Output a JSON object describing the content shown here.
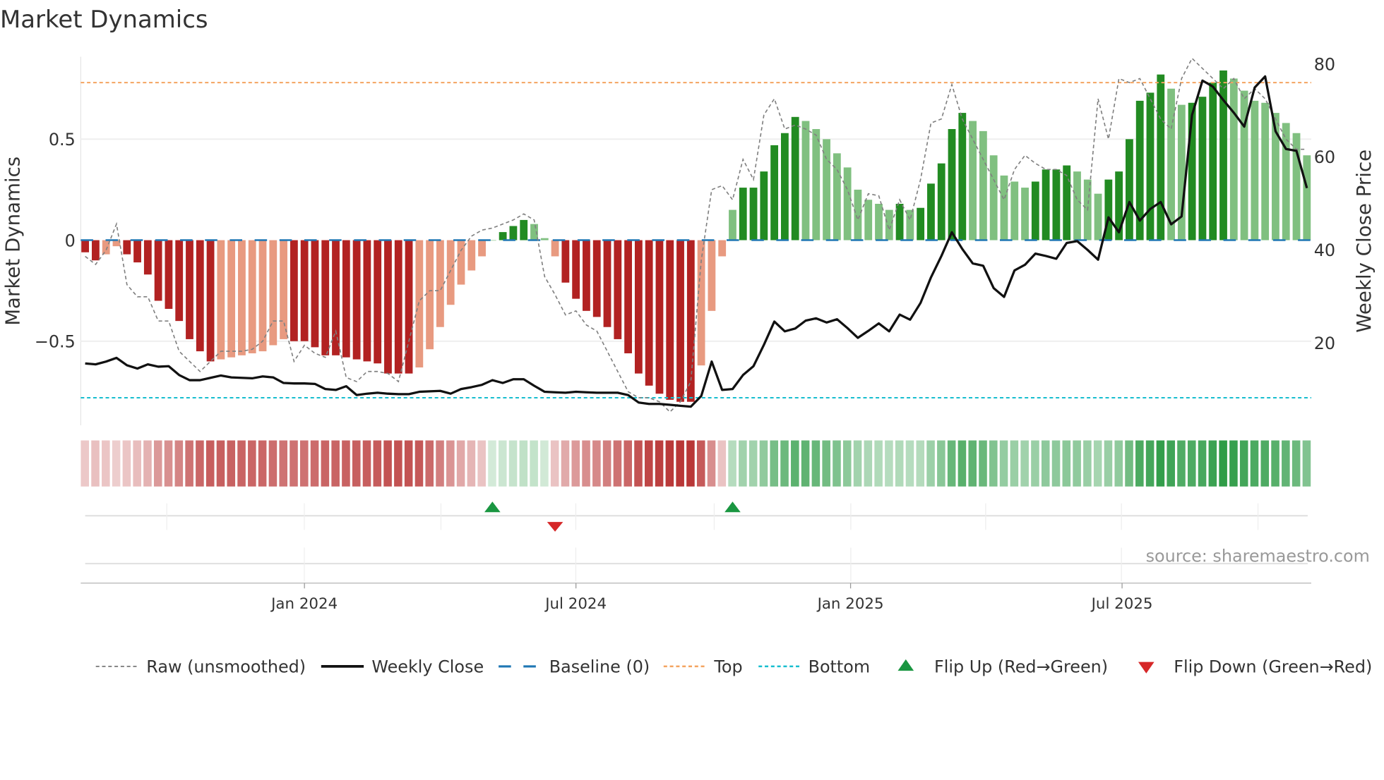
{
  "chart_data": {
    "type": "bar",
    "title": "Market Dynamics",
    "ylabel": "Market Dynamics",
    "y2label": "Weekly Close Price",
    "ylim": [
      -0.92,
      0.92
    ],
    "y2lim": [
      0,
      83
    ],
    "yticks": [
      {
        "v": 0.5,
        "label": "0.5"
      },
      {
        "v": 0,
        "label": "0"
      },
      {
        "v": -0.5,
        "label": "−0.5"
      }
    ],
    "y2ticks": [
      {
        "v": 80,
        "label": "80"
      },
      {
        "v": 60,
        "label": "60"
      },
      {
        "v": 40,
        "label": "40"
      },
      {
        "v": 20,
        "label": "20"
      }
    ],
    "xticks": [
      {
        "week": 21,
        "label": "Jan 2024"
      },
      {
        "week": 47,
        "label": "Jul 2024"
      },
      {
        "week": 73.3,
        "label": "Jan 2025"
      },
      {
        "week": 99.3,
        "label": "Jul 2025"
      }
    ],
    "frequency": "weekly",
    "values": [
      -0.06,
      -0.1,
      -0.07,
      -0.03,
      -0.07,
      -0.11,
      -0.17,
      -0.3,
      -0.34,
      -0.4,
      -0.49,
      -0.55,
      -0.6,
      -0.59,
      -0.58,
      -0.57,
      -0.56,
      -0.55,
      -0.52,
      -0.49,
      -0.5,
      -0.5,
      -0.53,
      -0.57,
      -0.57,
      -0.58,
      -0.59,
      -0.6,
      -0.61,
      -0.66,
      -0.66,
      -0.66,
      -0.63,
      -0.54,
      -0.43,
      -0.32,
      -0.22,
      -0.15,
      -0.08,
      0.0,
      0.04,
      0.07,
      0.1,
      0.08,
      0.01,
      -0.08,
      -0.21,
      -0.29,
      -0.35,
      -0.38,
      -0.43,
      -0.49,
      -0.56,
      -0.66,
      -0.72,
      -0.76,
      -0.79,
      -0.8,
      -0.8,
      -0.62,
      -0.35,
      -0.08,
      0.15,
      0.26,
      0.26,
      0.34,
      0.47,
      0.53,
      0.61,
      0.59,
      0.55,
      0.5,
      0.43,
      0.36,
      0.25,
      0.2,
      0.18,
      0.15,
      0.18,
      0.15,
      0.16,
      0.28,
      0.38,
      0.55,
      0.63,
      0.59,
      0.54,
      0.42,
      0.32,
      0.29,
      0.26,
      0.29,
      0.35,
      0.35,
      0.37,
      0.34,
      0.3,
      0.23,
      0.3,
      0.34,
      0.5,
      0.69,
      0.73,
      0.82,
      0.75,
      0.67,
      0.68,
      0.71,
      0.78,
      0.84,
      0.8,
      0.74,
      0.69,
      0.68,
      0.63,
      0.58,
      0.53,
      0.42
    ],
    "raw": [
      -0.08,
      -0.12,
      -0.05,
      0.08,
      -0.22,
      -0.28,
      -0.28,
      -0.4,
      -0.4,
      -0.55,
      -0.6,
      -0.65,
      -0.6,
      -0.55,
      -0.55,
      -0.55,
      -0.54,
      -0.5,
      -0.4,
      -0.4,
      -0.6,
      -0.52,
      -0.56,
      -0.58,
      -0.45,
      -0.68,
      -0.7,
      -0.65,
      -0.65,
      -0.66,
      -0.7,
      -0.5,
      -0.3,
      -0.25,
      -0.25,
      -0.15,
      -0.05,
      0.02,
      0.05,
      0.06,
      0.08,
      0.1,
      0.13,
      0.1,
      -0.18,
      -0.27,
      -0.37,
      -0.35,
      -0.42,
      -0.45,
      -0.55,
      -0.65,
      -0.75,
      -0.78,
      -0.78,
      -0.8,
      -0.85,
      -0.8,
      -0.7,
      -0.1,
      0.25,
      0.27,
      0.2,
      0.4,
      0.3,
      0.62,
      0.7,
      0.55,
      0.57,
      0.55,
      0.52,
      0.4,
      0.35,
      0.25,
      0.1,
      0.23,
      0.22,
      0.05,
      0.2,
      0.1,
      0.3,
      0.58,
      0.6,
      0.77,
      0.6,
      0.5,
      0.4,
      0.3,
      0.2,
      0.35,
      0.42,
      0.38,
      0.35,
      0.35,
      0.32,
      0.2,
      0.15,
      0.7,
      0.5,
      0.8,
      0.78,
      0.8,
      0.7,
      0.6,
      0.55,
      0.8,
      0.9,
      0.85,
      0.8,
      0.75,
      0.8,
      0.7,
      0.75,
      0.7,
      0.6,
      0.5,
      0.45,
      0.45
    ],
    "close": [
      15.6,
      15.4,
      16,
      16.8,
      15.2,
      14.5,
      15.4,
      14.9,
      15,
      13.1,
      12,
      12,
      12.5,
      13,
      12.6,
      12.5,
      12.4,
      12.8,
      12.6,
      11.4,
      11.3,
      11.3,
      11.2,
      10.1,
      9.9,
      10.7,
      8.8,
      9.1,
      9.3,
      9.1,
      9,
      9,
      9.5,
      9.6,
      9.7,
      9.1,
      10.1,
      10.5,
      11,
      12,
      11.4,
      12.2,
      12.2,
      10.8,
      9.5,
      9.4,
      9.3,
      9.5,
      9.4,
      9.3,
      9.3,
      9.3,
      8.8,
      7.2,
      6.9,
      6.9,
      6.7,
      6.5,
      6.3,
      8.6,
      16,
      9.9,
      10.1,
      13.1,
      15,
      19.6,
      24.6,
      22.5,
      23.1,
      24.8,
      25.3,
      24.4,
      25.1,
      23.2,
      21.1,
      22.6,
      24.2,
      22.5,
      26.1,
      25,
      28.6,
      34.1,
      38.7,
      43.8,
      40.2,
      37.1,
      36.6,
      31.8,
      29.9,
      35.6,
      36.8,
      39.2,
      38.7,
      38.1,
      41.5,
      41.9,
      40,
      37.9,
      47,
      43.8,
      50.3,
      46.3,
      48.8,
      50.3,
      45.5,
      47.2,
      69,
      76.4,
      75.1,
      72.2,
      69.5,
      66.5,
      74.9,
      77.3,
      65.5,
      61.7,
      61.3,
      53.3
    ],
    "baseline": 0,
    "top": 0.78,
    "bottom": -0.78,
    "flips": [
      {
        "week": 39,
        "type": "up"
      },
      {
        "week": 45,
        "type": "down"
      },
      {
        "week": 62,
        "type": "up"
      }
    ],
    "legend": {
      "placement": "bottom",
      "items": [
        "Raw (unsmoothed)",
        "Weekly Close",
        "Baseline (0)",
        "Top",
        "Bottom",
        "Flip Up (Red→Green)",
        "Flip Down (Green→Red)"
      ]
    },
    "source": "source: sharemaestro.com",
    "colors": {
      "red_strong": "#b22222",
      "red_weak": "#e89a80",
      "green_strong": "#228b22",
      "green_weak": "#80c080",
      "raw": "#808080",
      "close": "#111111",
      "baseline": "#1f77b4",
      "top": "#f4a460",
      "bottom": "#17becf",
      "flip_up": "#1a9641",
      "flip_down": "#d62728"
    }
  }
}
